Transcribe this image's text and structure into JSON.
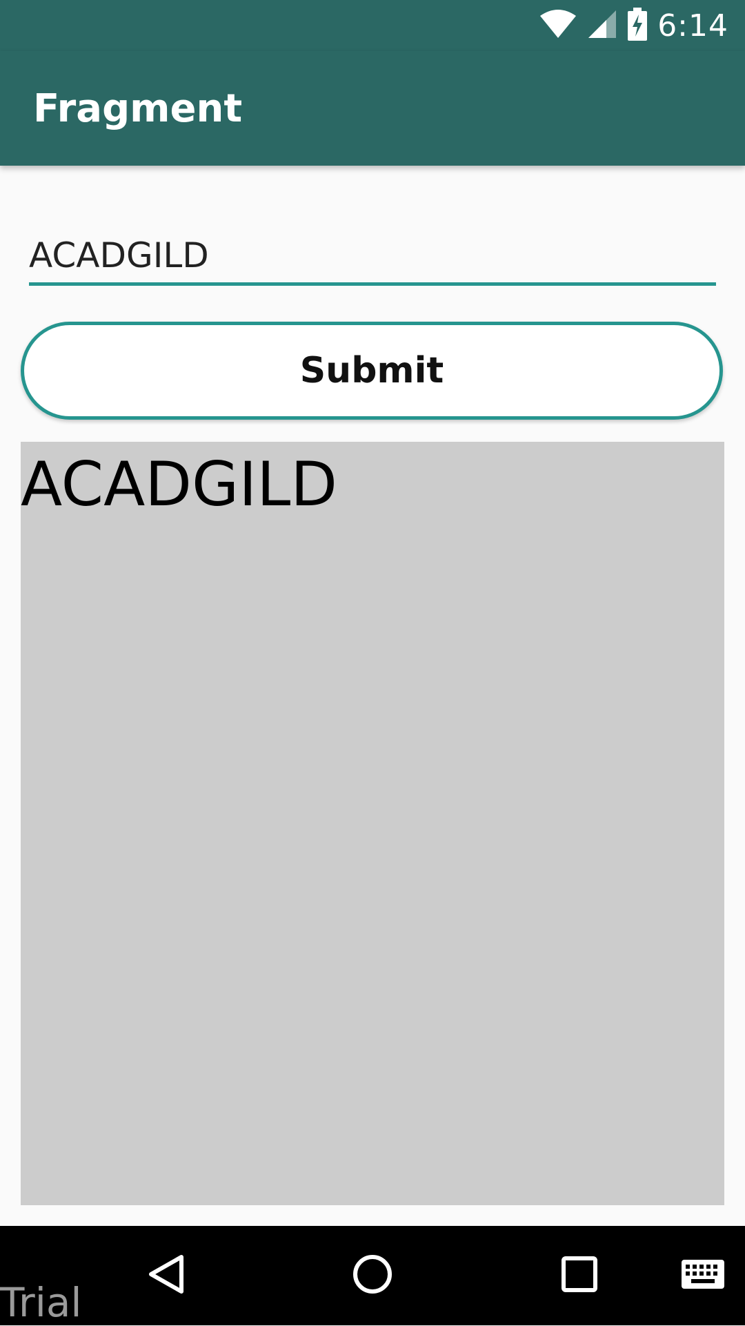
{
  "status_bar": {
    "time": "6:14",
    "icons": [
      "wifi-icon",
      "cell-signal-icon",
      "battery-charging-icon"
    ],
    "background": "#2b6864"
  },
  "app_bar": {
    "title": "Fragment",
    "background": "#2b6864"
  },
  "form": {
    "input_value": "ACADGILD",
    "submit_label": "Submit",
    "accent_color": "#26958f"
  },
  "result": {
    "text": "ACADGILD",
    "background": "#cccccc"
  },
  "nav_bar": {
    "icons": [
      "back-icon",
      "home-icon",
      "recents-icon",
      "keyboard-icon"
    ],
    "watermark": "Trial"
  }
}
